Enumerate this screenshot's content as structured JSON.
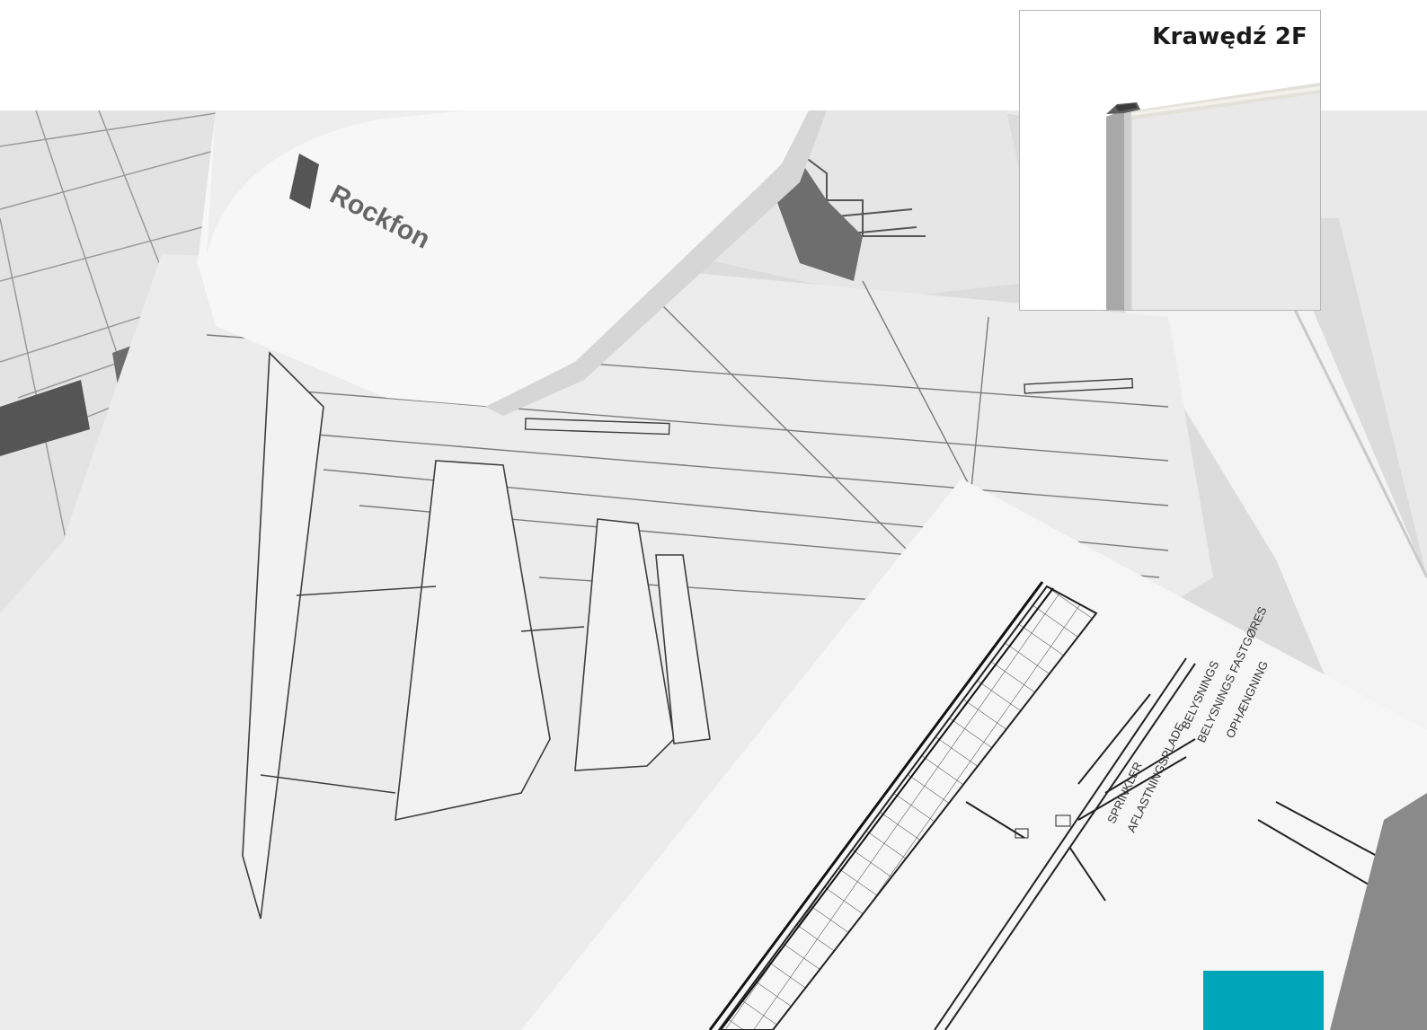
{
  "card": {
    "title": "Krawędź 2F"
  },
  "photo": {
    "helmet_brand": "Rockfon",
    "drawing_labels": {
      "sprinkler": "SPRINKLER",
      "aflastningsplade": "AFLASTNINGSPLADE",
      "belysnings": "BELYSNINGS",
      "belysnings_fastgores": "BELYSNINGS FASTGØRES",
      "ophaengning": "OPHÆNGNING"
    }
  },
  "colors": {
    "accent": "#00a6b7",
    "card_border": "#b5b5b5",
    "title": "#1a1a1a"
  },
  "icons": {
    "edge_profile": "panel-edge-2f-icon"
  }
}
